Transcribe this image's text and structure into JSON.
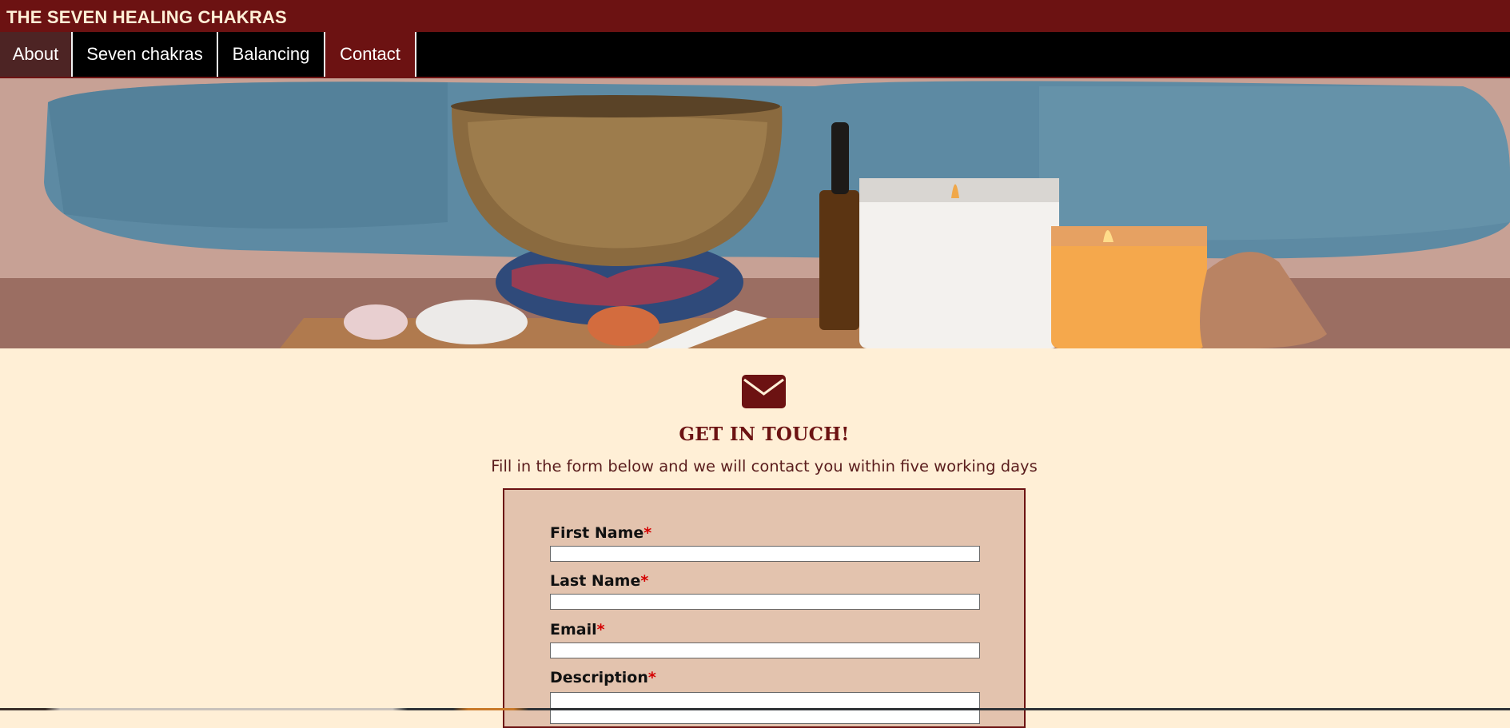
{
  "header": {
    "site_title": "THE SEVEN HEALING CHAKRAS"
  },
  "nav": {
    "items": [
      {
        "label": "About"
      },
      {
        "label": "Seven chakras"
      },
      {
        "label": "Balancing"
      },
      {
        "label": "Contact"
      }
    ]
  },
  "hero": {
    "image_icon": "singing-bowl-candles-photo"
  },
  "contact": {
    "icon": "envelope-icon",
    "heading": "GET IN TOUCH!",
    "subtext": "Fill in the form below and we will contact you within five working days",
    "required_marker": "*",
    "fields": [
      {
        "label": "First Name",
        "value": ""
      },
      {
        "label": "Last Name",
        "value": ""
      },
      {
        "label": "Email",
        "value": ""
      },
      {
        "label": "Description",
        "value": ""
      }
    ]
  },
  "colors": {
    "brand": "#6c1212",
    "background": "#ffefd6",
    "form_background": "#e3c3ae",
    "required": "#d40000"
  }
}
